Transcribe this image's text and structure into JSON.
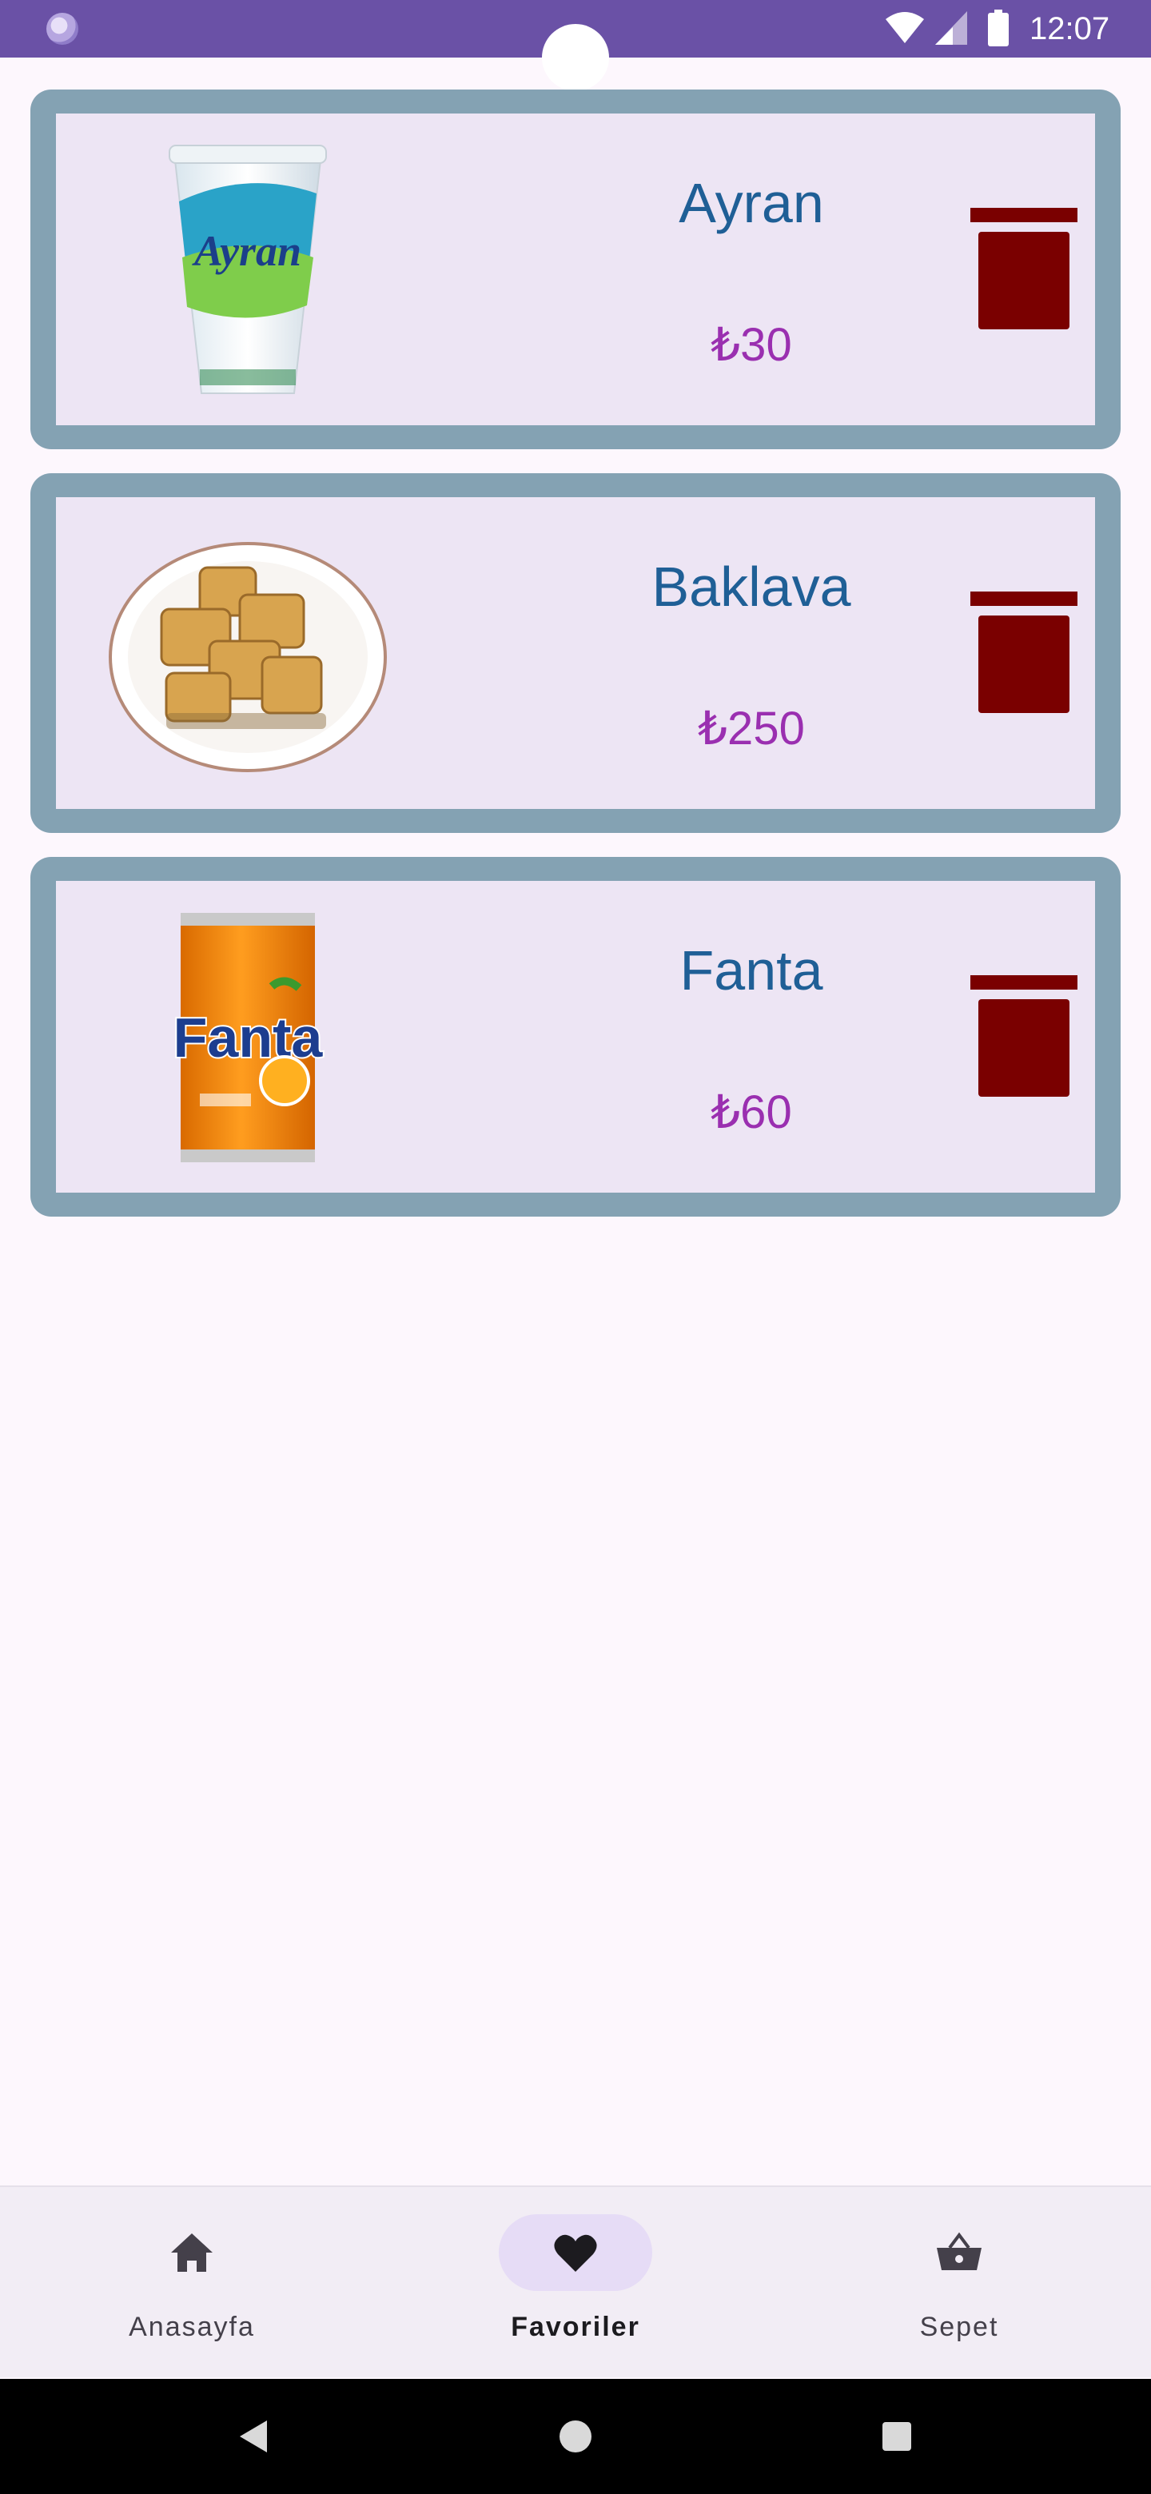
{
  "status_bar": {
    "time": "12:07",
    "icons": [
      "app-notification-icon",
      "wifi-icon",
      "signal-icon",
      "battery-icon"
    ]
  },
  "favorites": [
    {
      "name": "Ayran",
      "price": "₺30",
      "image": "ayran-cup"
    },
    {
      "name": "Baklava",
      "price": "₺250",
      "image": "baklava-plate"
    },
    {
      "name": "Fanta",
      "price": "₺60",
      "image": "fanta-can"
    }
  ],
  "delete_icon": "trash-icon",
  "bottom_nav": {
    "items": [
      {
        "label": "Anasayfa",
        "icon": "home-icon",
        "active": false
      },
      {
        "label": "Favoriler",
        "icon": "heart-icon",
        "active": true
      },
      {
        "label": "Sepet",
        "icon": "basket-icon",
        "active": false
      }
    ]
  },
  "system_nav": [
    "back-button",
    "home-button",
    "recents-button"
  ],
  "colors": {
    "status_bar": "#6a51a6",
    "card_border": "#84a2b3",
    "card_fill": "#ede5f4",
    "name_text": "#1f5f96",
    "price_text": "#9a2fb0",
    "trash": "#7a0000",
    "nav_active_pill": "#e6dcf6"
  }
}
